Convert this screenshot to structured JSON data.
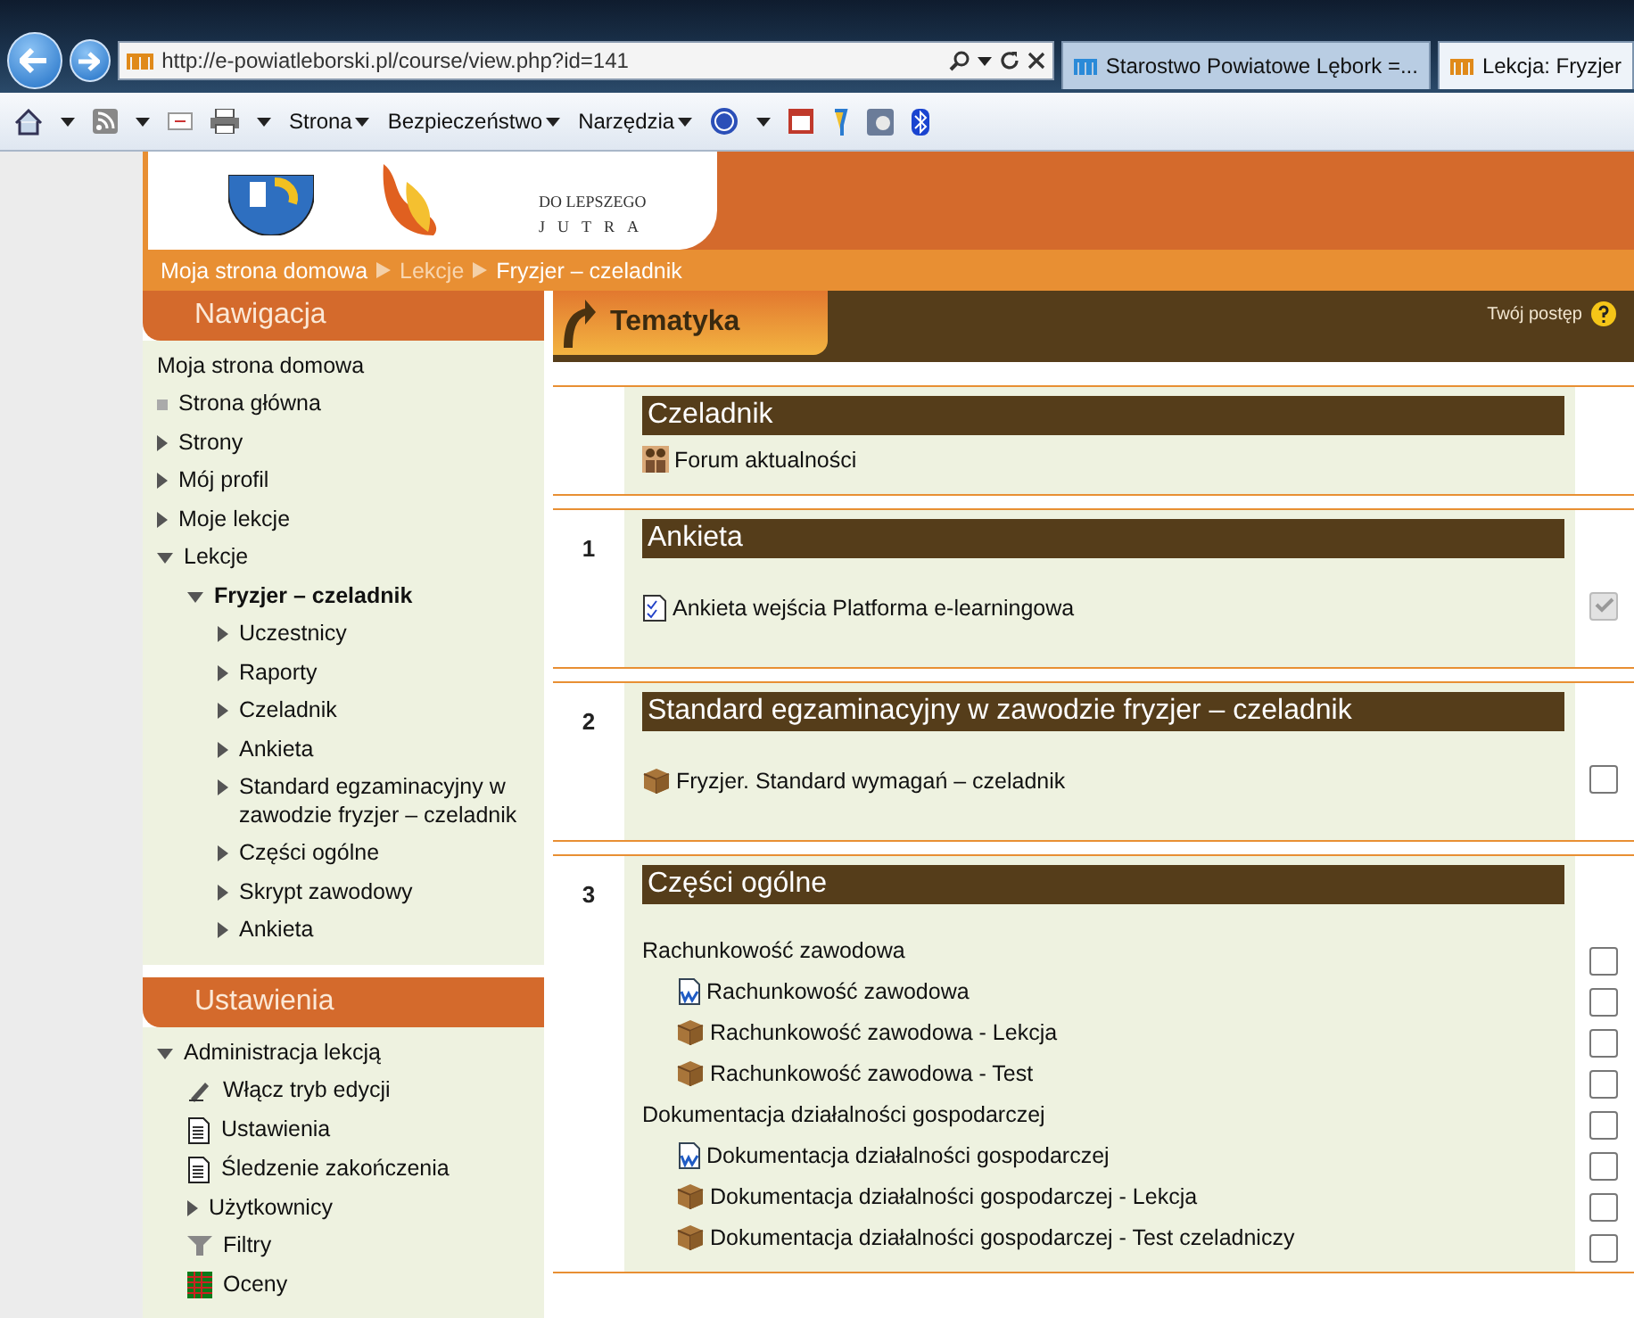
{
  "browser": {
    "address": "http://e-powiatleborski.pl/course/view.php?id=141",
    "tabs": [
      {
        "title": "Starostwo Powiatowe Lębork =...",
        "selected": false
      },
      {
        "title": "Lekcja: Fryzjer",
        "selected": true
      }
    ],
    "menus": [
      "Strona",
      "Bezpieczeństwo",
      "Narzędzia"
    ]
  },
  "banner": {
    "tagline_top": "DO LEPSZEGO",
    "tagline_bottom": "JUTRA"
  },
  "breadcrumb": [
    {
      "label": "Moja strona domowa",
      "muted": false
    },
    {
      "label": "Lekcje",
      "muted": true
    },
    {
      "label": "Fryzjer – czeladnik",
      "muted": false
    }
  ],
  "navigation": {
    "title": "Nawigacja",
    "items": [
      {
        "label": "Moja strona domowa",
        "kind": "home"
      },
      {
        "label": "Strona główna",
        "kind": "leaf"
      },
      {
        "label": "Strony",
        "kind": "branch",
        "expanded": false
      },
      {
        "label": "Mój profil",
        "kind": "branch",
        "expanded": false
      },
      {
        "label": "Moje lekcje",
        "kind": "branch",
        "expanded": false
      },
      {
        "label": "Lekcje",
        "kind": "branch",
        "expanded": true,
        "children": [
          {
            "label": "Fryzjer – czeladnik",
            "kind": "branch",
            "expanded": true,
            "current": true,
            "children": [
              {
                "label": "Uczestnicy",
                "kind": "branch",
                "expanded": false
              },
              {
                "label": "Raporty",
                "kind": "branch",
                "expanded": false
              },
              {
                "label": "Czeladnik",
                "kind": "branch",
                "expanded": false
              },
              {
                "label": "Ankieta",
                "kind": "branch",
                "expanded": false
              },
              {
                "label": "Standard egzaminacyjny w zawodzie fryzjer – czeladnik",
                "kind": "branch",
                "expanded": false
              },
              {
                "label": "Części ogólne",
                "kind": "branch",
                "expanded": false
              },
              {
                "label": "Skrypt zawodowy",
                "kind": "branch",
                "expanded": false
              },
              {
                "label": "Ankieta",
                "kind": "branch",
                "expanded": false
              }
            ]
          }
        ]
      }
    ]
  },
  "settings": {
    "title": "Ustawienia",
    "items": [
      {
        "label": "Administracja lekcją",
        "kind": "branch",
        "expanded": true,
        "children": [
          {
            "label": "Włącz tryb edycji",
            "kind": "edit"
          },
          {
            "label": "Ustawienia",
            "kind": "page"
          },
          {
            "label": "Śledzenie zakończenia",
            "kind": "page"
          },
          {
            "label": "Użytkownicy",
            "kind": "branch",
            "expanded": false
          },
          {
            "label": "Filtry",
            "kind": "filter"
          },
          {
            "label": "Oceny",
            "kind": "grades"
          }
        ]
      }
    ]
  },
  "course": {
    "tab": "Tematyka",
    "progress_label": "Twój postęp",
    "sections": [
      {
        "title": "Czeladnik",
        "activities": [
          {
            "label": "Forum aktualności",
            "kind": "forum"
          }
        ]
      },
      {
        "number": "1",
        "title": "Ankieta",
        "activities": [
          {
            "label": "Ankieta wejścia Platforma e-learningowa",
            "kind": "survey",
            "checked": true
          }
        ]
      },
      {
        "number": "2",
        "title": "Standard egzaminacyjny w zawodzie fryzjer – czeladnik",
        "activities": [
          {
            "label": "Fryzjer. Standard wymagań – czeladnik",
            "kind": "package",
            "checked": false
          }
        ]
      },
      {
        "number": "3",
        "title": "Części ogólne",
        "activities": [
          {
            "label": "Rachunkowość zawodowa",
            "kind": "label",
            "checked": false,
            "children": [
              {
                "label": "Rachunkowość zawodowa",
                "kind": "word",
                "checked": false
              },
              {
                "label": "Rachunkowość zawodowa - Lekcja",
                "kind": "package",
                "checked": false
              },
              {
                "label": "Rachunkowość zawodowa - Test",
                "kind": "package",
                "checked": false
              }
            ]
          },
          {
            "label": "Dokumentacja działalności gospodarczej",
            "kind": "label",
            "checked": false,
            "children": [
              {
                "label": "Dokumentacja działalności gospodarczej",
                "kind": "word",
                "checked": false
              },
              {
                "label": "Dokumentacja działalności gospodarczej - Lekcja",
                "kind": "package",
                "checked": false
              },
              {
                "label": "Dokumentacja działalności gospodarczej - Test czeladniczy",
                "kind": "package",
                "checked": false
              }
            ]
          }
        ]
      }
    ]
  }
}
